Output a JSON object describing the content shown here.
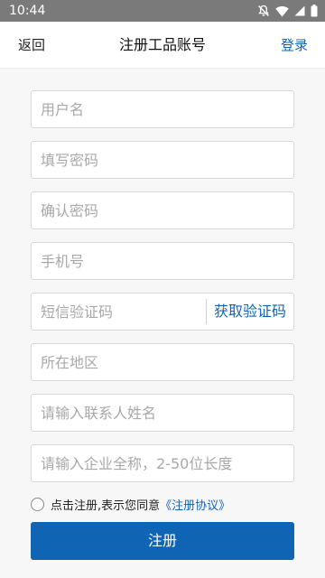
{
  "status_bar": {
    "time": "10:44"
  },
  "nav": {
    "back_label": "返回",
    "title": "注册工品账号",
    "login_label": "登录"
  },
  "form": {
    "username_placeholder": "用户名",
    "password_placeholder": "填写密码",
    "confirm_password_placeholder": "确认密码",
    "phone_placeholder": "手机号",
    "sms_code_placeholder": "短信验证码",
    "get_code_label": "获取验证码",
    "region_placeholder": "所在地区",
    "contact_name_placeholder": "请输入联系人姓名",
    "company_name_placeholder": "请输入企业全称，2-50位长度"
  },
  "agreement": {
    "text": "点击注册,表示您同意",
    "link": "《注册协议》"
  },
  "submit": {
    "label": "注册"
  },
  "colors": {
    "accent": "#1164b4",
    "status_bar": "#7a7a7a",
    "background": "#f7f7f7"
  }
}
